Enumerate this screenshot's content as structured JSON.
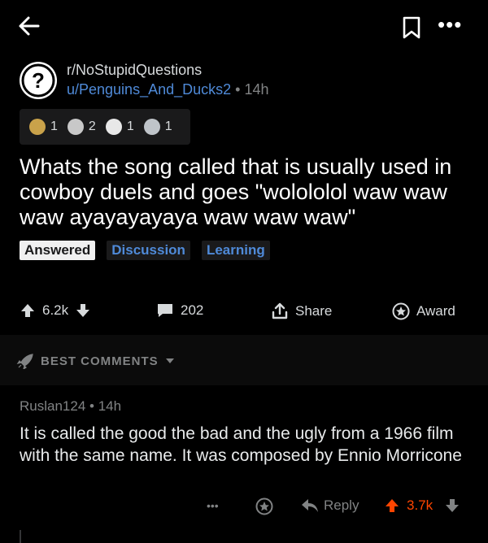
{
  "header": {
    "more_label": "•••"
  },
  "post": {
    "subreddit": "r/NoStupidQuestions",
    "author": "u/Penguins_And_Ducks2",
    "sep": "•",
    "age": "14h",
    "awards": [
      {
        "icon": "award-silver-icon",
        "count": "1",
        "color": "#c9a24a"
      },
      {
        "icon": "award-skull-icon",
        "count": "2",
        "color": "#c8c8c8"
      },
      {
        "icon": "award-cloud-icon",
        "count": "1",
        "color": "#e8e8e8"
      },
      {
        "icon": "award-silver-s-icon",
        "count": "1",
        "color": "#bfc4c9"
      }
    ],
    "title": "Whats the song called that is usually used in cowboy duels and goes \"wolololol waw waw waw ayayayayaya waw waw waw\"",
    "flairs": [
      {
        "label": "Answered",
        "style": "ans"
      },
      {
        "label": "Discussion",
        "style": "blue"
      },
      {
        "label": "Learning",
        "style": "blue"
      }
    ],
    "votes": "6.2k",
    "comments": "202",
    "share_label": "Share",
    "award_label": "Award"
  },
  "sort": {
    "label": "BEST COMMENTS"
  },
  "comment": {
    "author": "Ruslan124",
    "sep": "•",
    "age": "14h",
    "body": "It is called the good the bad and the ugly from a 1966 film with the same name. It was composed by Ennio Morricone",
    "more_label": "•••",
    "reply_label": "Reply",
    "votes": "3.7k",
    "vote_color": "#ff4500"
  }
}
